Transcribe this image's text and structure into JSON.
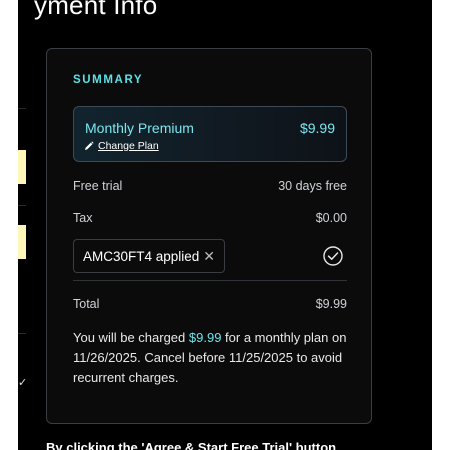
{
  "page": {
    "heading": "yment Info"
  },
  "summary": {
    "title": "SUMMARY",
    "plan": {
      "name": "Monthly Premium",
      "price": "$9.99",
      "change_label": "Change Plan"
    },
    "rows": {
      "free_trial": {
        "label": "Free trial",
        "value": "30 days free"
      },
      "tax": {
        "label": "Tax",
        "value": "$0.00"
      },
      "total": {
        "label": "Total",
        "value": "$9.99"
      }
    },
    "coupon": {
      "code": "AMC30FT4 applied",
      "remove_glyph": "✕",
      "status_icon": "check-circle-icon"
    },
    "charge_notice": {
      "before": "You will be charged ",
      "amount": "$9.99",
      "after": " for a monthly plan on 11/26/2025. Cancel before 11/25/2025 to avoid recurrent charges."
    }
  },
  "footer": {
    "consent_text": "By clicking the 'Agree & Start Free Trial' button"
  },
  "side": {
    "check_glyph": "✓"
  },
  "colors": {
    "accent": "#5ce1e6",
    "background": "#000000",
    "card_border": "#3a3d42",
    "tab_highlight": "#fff7b8"
  }
}
